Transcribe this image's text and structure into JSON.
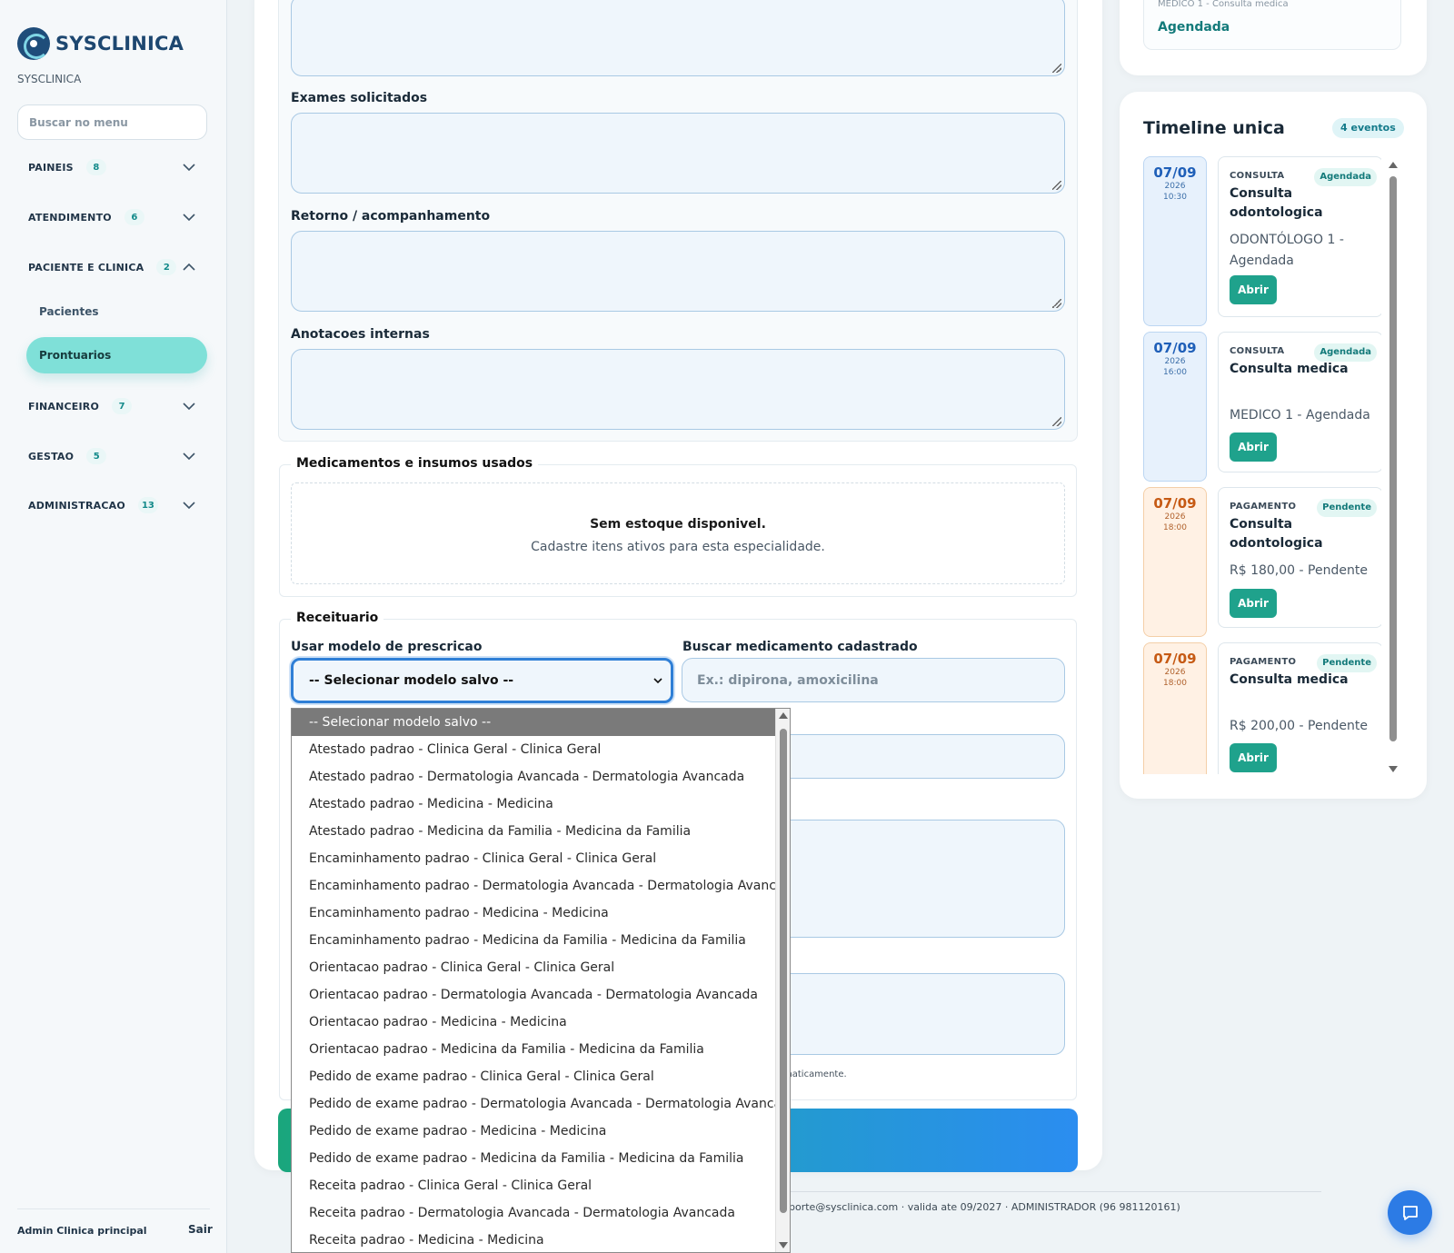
{
  "app": {
    "brand": "SYSCLINICA",
    "clinic_name": "SYSCLINICA"
  },
  "sidebar": {
    "search_placeholder": "Buscar no menu",
    "groups": [
      {
        "label": "PAINEIS",
        "count": "8",
        "expanded": false
      },
      {
        "label": "ATENDIMENTO",
        "count": "6",
        "expanded": false
      },
      {
        "label": "PACIENTE E CLINICA",
        "count": "2",
        "expanded": true
      },
      {
        "label": "FINANCEIRO",
        "count": "7",
        "expanded": false
      },
      {
        "label": "GESTAO",
        "count": "5",
        "expanded": false
      },
      {
        "label": "ADMINISTRACAO",
        "count": "13",
        "expanded": false
      }
    ],
    "sub_items": [
      {
        "label": "Pacientes",
        "active": false
      },
      {
        "label": "Prontuarios",
        "active": true
      }
    ],
    "user": "Admin Clinica principal",
    "logout": "Sair"
  },
  "form": {
    "labels": {
      "exames": "Exames solicitados",
      "retorno": "Retorno / acompanhamento",
      "anotacoes": "Anotacoes internas"
    },
    "medicamentos": {
      "legend": "Medicamentos e insumos usados",
      "empty_title": "Sem estoque disponivel.",
      "empty_sub": "Cadastre itens ativos para esta especialidade."
    },
    "receituario": {
      "legend": "Receituario",
      "modelo_label": "Usar modelo de prescricao",
      "modelo_selected": "-- Selecionar modelo salvo --",
      "buscar_label": "Buscar medicamento cadastrado",
      "buscar_placeholder": "Ex.: dipirona, amoxicilina",
      "hint_partial": "maticamente."
    },
    "dropdown_options": [
      "-- Selecionar modelo salvo --",
      "Atestado padrao - Clinica Geral - Clinica Geral",
      "Atestado padrao - Dermatologia Avancada - Dermatologia Avancada",
      "Atestado padrao - Medicina - Medicina",
      "Atestado padrao - Medicina da Familia - Medicina da Familia",
      "Encaminhamento padrao - Clinica Geral - Clinica Geral",
      "Encaminhamento padrao - Dermatologia Avancada - Dermatologia Avancada",
      "Encaminhamento padrao - Medicina - Medicina",
      "Encaminhamento padrao - Medicina da Familia - Medicina da Familia",
      "Orientacao padrao - Clinica Geral - Clinica Geral",
      "Orientacao padrao - Dermatologia Avancada - Dermatologia Avancada",
      "Orientacao padrao - Medicina - Medicina",
      "Orientacao padrao - Medicina da Familia - Medicina da Familia",
      "Pedido de exame padrao - Clinica Geral - Clinica Geral",
      "Pedido de exame padrao - Dermatologia Avancada - Dermatologia Avancada",
      "Pedido de exame padrao - Medicina - Medicina",
      "Pedido de exame padrao - Medicina da Familia - Medicina da Familia",
      "Receita padrao - Clinica Geral - Clinica Geral",
      "Receita padrao - Dermatologia Avancada - Dermatologia Avancada",
      "Receita padrao - Medicina - Medicina"
    ]
  },
  "footer": {
    "text": "porte@sysclinica.com · valida ate 09/2027 · ADMINISTRADOR (96 981120161)"
  },
  "right": {
    "top_event": {
      "meta": "MEDICO 1 - Consulta medica",
      "status": "Agendada"
    },
    "timeline": {
      "title": "Timeline unica",
      "count": "4 eventos",
      "events": [
        {
          "day": "07/09",
          "year": "2026",
          "time": "10:30",
          "color": "blue",
          "kind": "CONSULTA",
          "badge": "Agendada",
          "name": "Consulta odontologica",
          "desc": "ODONTÓLOGO 1 - Agendada",
          "action": "Abrir"
        },
        {
          "day": "07/09",
          "year": "2026",
          "time": "16:00",
          "color": "blue",
          "kind": "CONSULTA",
          "badge": "Agendada",
          "name": "Consulta medica",
          "desc": "MEDICO 1 - Agendada",
          "action": "Abrir"
        },
        {
          "day": "07/09",
          "year": "2026",
          "time": "18:00",
          "color": "orange",
          "kind": "PAGAMENTO",
          "badge": "Pendente",
          "name": "Consulta odontologica",
          "desc": "R$ 180,00 - Pendente",
          "action": "Abrir"
        },
        {
          "day": "07/09",
          "year": "2026",
          "time": "18:00",
          "color": "orange",
          "kind": "PAGAMENTO",
          "badge": "Pendente",
          "name": "Consulta medica",
          "desc": "R$ 200,00 - Pendente",
          "action": "Abrir"
        }
      ]
    }
  },
  "colors": {
    "accent": "#1fa28c",
    "primary": "#2c7be5",
    "active_nav": "#7fe0d8"
  }
}
